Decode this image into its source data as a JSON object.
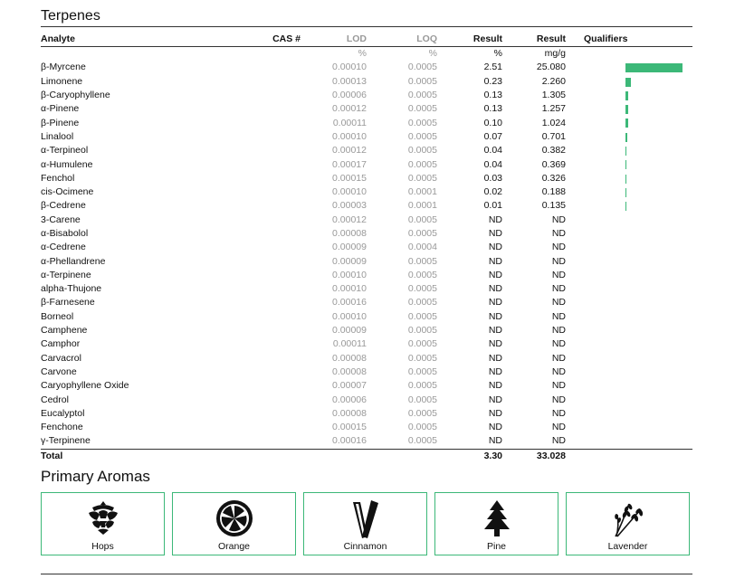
{
  "terpenes": {
    "title": "Terpenes",
    "headers": {
      "analyte": "Analyte",
      "cas": "CAS #",
      "lod": "LOD",
      "loq": "LOQ",
      "result_pct": "Result",
      "result_mg": "Result",
      "qualifiers": "Qualifiers"
    },
    "units": {
      "lod": "%",
      "loq": "%",
      "result_pct": "%",
      "result_mg": "mg/g"
    },
    "rows": [
      {
        "analyte": "β-Myrcene",
        "lod": "0.00010",
        "loq": "0.0005",
        "pct": "2.51",
        "mg": "25.080",
        "bar": 1.0
      },
      {
        "analyte": "Limonene",
        "lod": "0.00013",
        "loq": "0.0005",
        "pct": "0.23",
        "mg": "2.260",
        "bar": 0.09
      },
      {
        "analyte": "β-Caryophyllene",
        "lod": "0.00006",
        "loq": "0.0005",
        "pct": "0.13",
        "mg": "1.305",
        "bar": 0.052
      },
      {
        "analyte": "α-Pinene",
        "lod": "0.00012",
        "loq": "0.0005",
        "pct": "0.13",
        "mg": "1.257",
        "bar": 0.05
      },
      {
        "analyte": "β-Pinene",
        "lod": "0.00011",
        "loq": "0.0005",
        "pct": "0.10",
        "mg": "1.024",
        "bar": 0.041
      },
      {
        "analyte": "Linalool",
        "lod": "0.00010",
        "loq": "0.0005",
        "pct": "0.07",
        "mg": "0.701",
        "bar": 0.028
      },
      {
        "analyte": "α-Terpineol",
        "lod": "0.00012",
        "loq": "0.0005",
        "pct": "0.04",
        "mg": "0.382",
        "bar": 0.015
      },
      {
        "analyte": "α-Humulene",
        "lod": "0.00017",
        "loq": "0.0005",
        "pct": "0.04",
        "mg": "0.369",
        "bar": 0.015
      },
      {
        "analyte": "Fenchol",
        "lod": "0.00015",
        "loq": "0.0005",
        "pct": "0.03",
        "mg": "0.326",
        "bar": 0.013
      },
      {
        "analyte": "cis-Ocimene",
        "lod": "0.00010",
        "loq": "0.0001",
        "pct": "0.02",
        "mg": "0.188",
        "bar": 0.0075
      },
      {
        "analyte": "β-Cedrene",
        "lod": "0.00003",
        "loq": "0.0001",
        "pct": "0.01",
        "mg": "0.135",
        "bar": 0.0054
      },
      {
        "analyte": "3-Carene",
        "lod": "0.00012",
        "loq": "0.0005",
        "pct": "ND",
        "mg": "ND"
      },
      {
        "analyte": "α-Bisabolol",
        "lod": "0.00008",
        "loq": "0.0005",
        "pct": "ND",
        "mg": "ND"
      },
      {
        "analyte": "α-Cedrene",
        "lod": "0.00009",
        "loq": "0.0004",
        "pct": "ND",
        "mg": "ND"
      },
      {
        "analyte": "α-Phellandrene",
        "lod": "0.00009",
        "loq": "0.0005",
        "pct": "ND",
        "mg": "ND"
      },
      {
        "analyte": "α-Terpinene",
        "lod": "0.00010",
        "loq": "0.0005",
        "pct": "ND",
        "mg": "ND"
      },
      {
        "analyte": "alpha-Thujone",
        "lod": "0.00010",
        "loq": "0.0005",
        "pct": "ND",
        "mg": "ND"
      },
      {
        "analyte": "β-Farnesene",
        "lod": "0.00016",
        "loq": "0.0005",
        "pct": "ND",
        "mg": "ND"
      },
      {
        "analyte": "Borneol",
        "lod": "0.00010",
        "loq": "0.0005",
        "pct": "ND",
        "mg": "ND"
      },
      {
        "analyte": "Camphene",
        "lod": "0.00009",
        "loq": "0.0005",
        "pct": "ND",
        "mg": "ND"
      },
      {
        "analyte": "Camphor",
        "lod": "0.00011",
        "loq": "0.0005",
        "pct": "ND",
        "mg": "ND"
      },
      {
        "analyte": "Carvacrol",
        "lod": "0.00008",
        "loq": "0.0005",
        "pct": "ND",
        "mg": "ND"
      },
      {
        "analyte": "Carvone",
        "lod": "0.00008",
        "loq": "0.0005",
        "pct": "ND",
        "mg": "ND"
      },
      {
        "analyte": "Caryophyllene Oxide",
        "lod": "0.00007",
        "loq": "0.0005",
        "pct": "ND",
        "mg": "ND"
      },
      {
        "analyte": "Cedrol",
        "lod": "0.00006",
        "loq": "0.0005",
        "pct": "ND",
        "mg": "ND"
      },
      {
        "analyte": "Eucalyptol",
        "lod": "0.00008",
        "loq": "0.0005",
        "pct": "ND",
        "mg": "ND"
      },
      {
        "analyte": "Fenchone",
        "lod": "0.00015",
        "loq": "0.0005",
        "pct": "ND",
        "mg": "ND"
      },
      {
        "analyte": "γ-Terpinene",
        "lod": "0.00016",
        "loq": "0.0005",
        "pct": "ND",
        "mg": "ND"
      }
    ],
    "total": {
      "label": "Total",
      "pct": "3.30",
      "mg": "33.028"
    }
  },
  "aromas": {
    "title": "Primary Aromas",
    "items": [
      {
        "label": "Hops",
        "icon": "hops-icon"
      },
      {
        "label": "Orange",
        "icon": "orange-icon"
      },
      {
        "label": "Cinnamon",
        "icon": "cinnamon-icon"
      },
      {
        "label": "Pine",
        "icon": "pine-icon"
      },
      {
        "label": "Lavender",
        "icon": "lavender-icon"
      }
    ]
  },
  "colors": {
    "accent": "#3cb878",
    "muted": "#999999"
  }
}
